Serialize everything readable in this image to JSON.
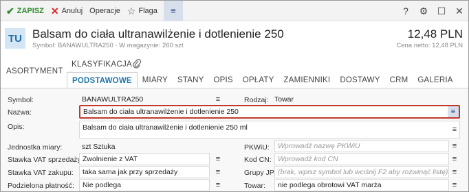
{
  "toolbar": {
    "save_label": "ZAPISZ",
    "cancel_label": "Anuluj",
    "operations_label": "Operacje",
    "flag_label": "Flaga",
    "icons": [
      "check-icon",
      "close-icon",
      "star-icon",
      "menu-icon",
      "help-icon",
      "gear-icon",
      "maximize-icon",
      "close-window-icon"
    ]
  },
  "header": {
    "avatar": "TU",
    "title": "Balsam do ciała ultranawilżenie i dotlenienie 250",
    "subtitle": "Symbol: BANAWULTRA250 · W magazynie: 260 szt",
    "price": "12,48 PLN",
    "net_price": "Cena netto: 12,48 PLN"
  },
  "tabs": {
    "assortment": "ASORTYMENT",
    "classification": "KLASYFIKACJA",
    "items": [
      {
        "label": "PODSTAWOWE",
        "active": true
      },
      {
        "label": "MIARY",
        "active": false
      },
      {
        "label": "STANY",
        "active": false
      },
      {
        "label": "OPIS",
        "active": false
      },
      {
        "label": "OPŁATY",
        "active": false
      },
      {
        "label": "ZAMIENNIKI",
        "active": false
      },
      {
        "label": "DOSTAWY",
        "active": false
      },
      {
        "label": "CRM",
        "active": false
      },
      {
        "label": "GALERIA",
        "active": false
      }
    ]
  },
  "form": {
    "symbol": {
      "label": "Symbol:",
      "value": "BANAWULTRA250"
    },
    "rodzaj": {
      "label": "Rodzaj:",
      "value": "Towar"
    },
    "nazwa": {
      "label": "Nazwa:",
      "value": "Balsam do ciała ultranawilżenie i dotlenienie 250"
    },
    "opis": {
      "label": "Opis:",
      "value": "Balsam do ciała ultranawilżenie i dotlenienie 250 ml"
    },
    "jednostka": {
      "label": "Jednostka miary:",
      "value": "szt  Sztuka"
    },
    "pkwiu": {
      "label": "PKWiU:",
      "placeholder": "Wprowadź nazwę PKWiU"
    },
    "vat_sprzedazy": {
      "label": "Stawka VAT sprzedaży:",
      "value": "Zwolnienie z VAT"
    },
    "kod_cn": {
      "label": "Kod CN:",
      "placeholder": "Wprowadź kod CN"
    },
    "vat_zakupu": {
      "label": "Stawka VAT zakupu:",
      "value": "taka sama jak przy sprzedaży"
    },
    "grupy_jpk": {
      "label": "Grupy JPK:",
      "placeholder": "(brak, wpisz symbol lub wciśnij F2 aby rozwinąć listę)"
    },
    "podzielona": {
      "label": "Podzielona płatność:",
      "value": "Nie podlega"
    },
    "towar": {
      "label": "Towar:",
      "value": "nie podlega obrotowi VAT marża"
    }
  }
}
